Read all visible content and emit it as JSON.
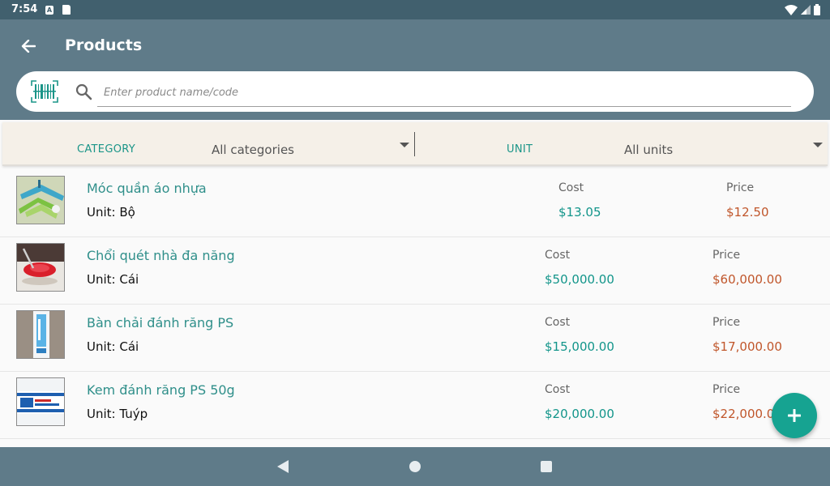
{
  "status_bar": {
    "time": "7:54",
    "notification_icon": "A"
  },
  "header": {
    "title": "Products"
  },
  "search": {
    "placeholder": "Enter product name/code",
    "value": ""
  },
  "filters": {
    "category": {
      "label": "CATEGORY",
      "value": "All categories"
    },
    "unit": {
      "label": "UNIT",
      "value": "All units"
    }
  },
  "columns": {
    "cost": "Cost",
    "price": "Price"
  },
  "products": [
    {
      "name": "Móc quần áo nhựa",
      "unit": "Unit: Bộ",
      "cost": "$13.05",
      "price": "$12.50"
    },
    {
      "name": "Chổi quét nhà đa năng",
      "unit": "Unit: Cái",
      "cost": "$50,000.00",
      "price": "$60,000.00"
    },
    {
      "name": "Bàn chải đánh răng PS",
      "unit": "Unit: Cái",
      "cost": "$15,000.00",
      "price": "$17,000.00"
    },
    {
      "name": "Kem đánh răng PS 50g",
      "unit": "Unit: Tuýp",
      "cost": "$20,000.00",
      "price": "$22,000.00"
    }
  ],
  "colors": {
    "app_bar": "#5f7b89",
    "status_bar": "#41606e",
    "accent": "#16a391",
    "cost": "#12958a",
    "price": "#c0562b",
    "name": "#2f8f8a"
  },
  "icons": [
    "back-arrow-icon",
    "barcode-scan-icon",
    "search-icon",
    "dropdown-caret-icon",
    "plus-icon",
    "wifi-icon",
    "signal-icon",
    "battery-icon"
  ]
}
